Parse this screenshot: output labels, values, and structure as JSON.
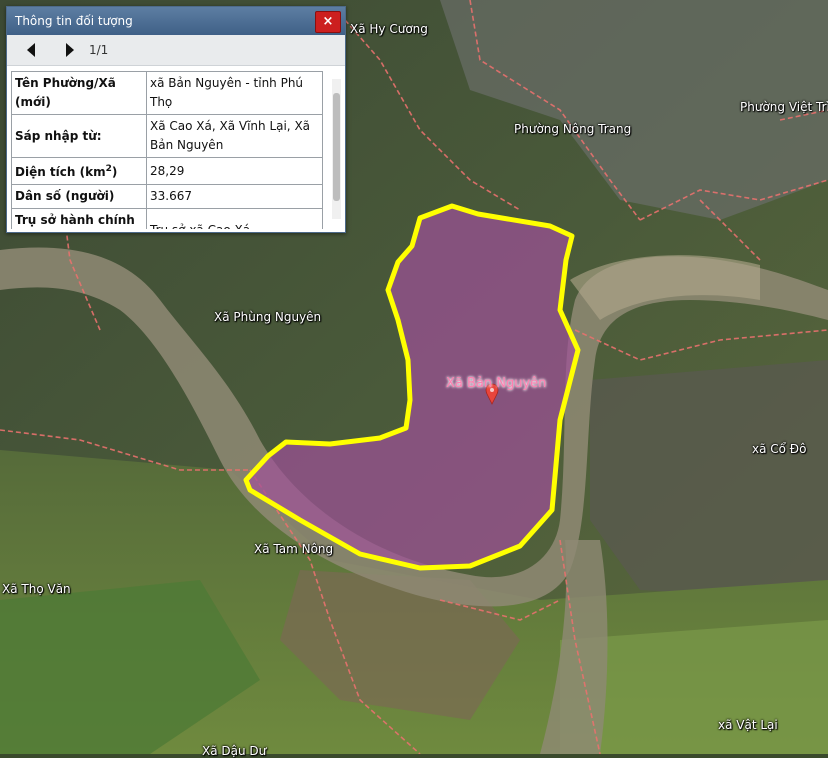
{
  "panel": {
    "title": "Thông tin đối tượng",
    "close_label": "×",
    "pager_count": "1/1"
  },
  "info_rows": [
    {
      "key": "Tên Phường/Xã (mới)",
      "value": "xã Bản Nguyên - tỉnh Phú Thọ"
    },
    {
      "key": "Sáp nhập từ:",
      "value": "Xã Cao Xá, Xã Vĩnh Lại, Xã Bản Nguyên"
    },
    {
      "key": "Diện tích (km2)",
      "value": "28,29"
    },
    {
      "key": "Dân số (người)",
      "value": "33.667"
    },
    {
      "key": "Trụ sở hành chính (mới)",
      "value": "Trụ sở xã Cao Xá"
    }
  ],
  "map_labels": {
    "hy_cuong": "Xã Hy Cương",
    "nong_trang": "Phường Nông Trang",
    "viet_tri": "Phường Việt Trì",
    "phung_nguyen": "Xã Phùng Nguyên",
    "ban_nguyen": "Xã Bản Nguyên",
    "co_do": "xã Cổ Đô",
    "tam_nong": "Xã Tam Nông",
    "tho_van": "Xã Thọ Văn",
    "vat_lai": "xã Vật Lại",
    "bottom_partial": "Xã Dậu Dư"
  },
  "colors": {
    "highlight_fill": "#a0509a",
    "highlight_border": "#ffff00",
    "boundary": "#e8716e",
    "marker": "#e8453c",
    "close_button": "#cc1f1f"
  },
  "icons": {
    "marker": "map-pin-icon",
    "prev": "triangle-left-icon",
    "next": "triangle-right-icon",
    "close": "close-icon"
  }
}
